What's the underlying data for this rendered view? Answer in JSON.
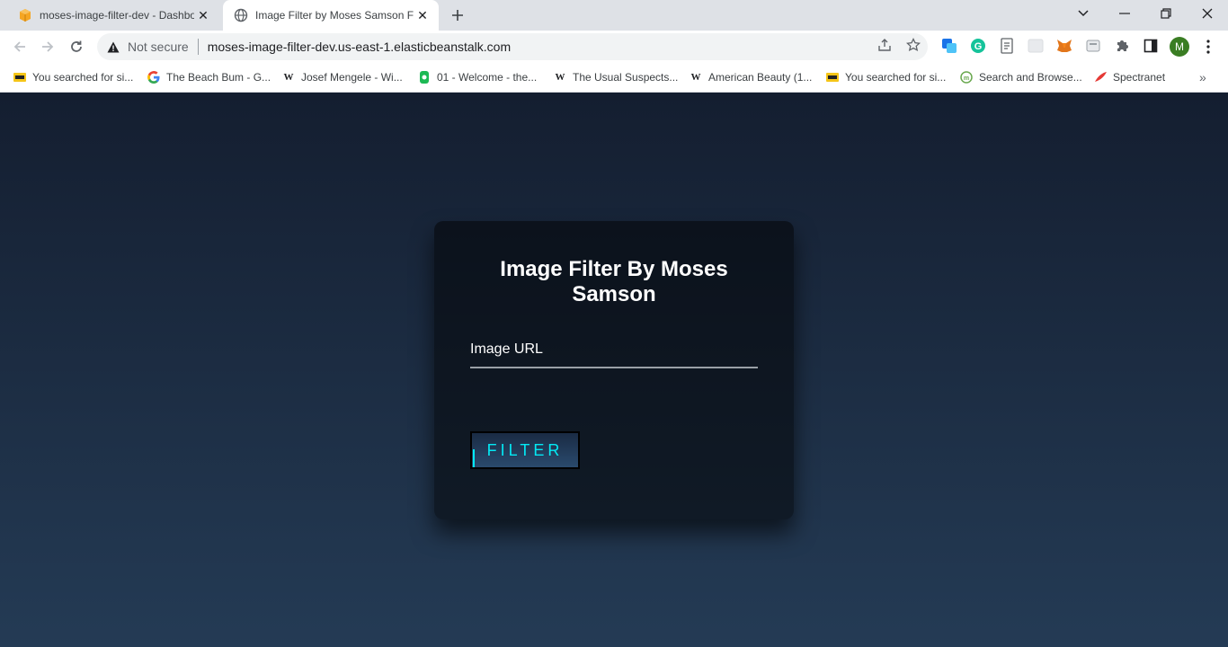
{
  "browser": {
    "tabs": [
      {
        "title": "moses-image-filter-dev - Dashbo",
        "icon": "aws-box-icon",
        "active": false
      },
      {
        "title": "Image Filter by Moses Samson Fo",
        "icon": "globe-icon",
        "active": true
      }
    ],
    "address": {
      "security_label": "Not secure",
      "url": "moses-image-filter-dev.us-east-1.elasticbeanstalk.com"
    },
    "bookmarks": [
      {
        "label": "You searched for si...",
        "icon": "imdb-icon"
      },
      {
        "label": "The Beach Bum - G...",
        "icon": "google-icon"
      },
      {
        "label": "Josef Mengele - Wi...",
        "icon": "wikipedia-icon"
      },
      {
        "label": "01 - Welcome - the...",
        "icon": "course-icon"
      },
      {
        "label": "The Usual Suspects...",
        "icon": "wikipedia-icon"
      },
      {
        "label": "American Beauty (1...",
        "icon": "wikipedia-icon"
      },
      {
        "label": "You searched for si...",
        "icon": "imdb-icon"
      },
      {
        "label": "Search and Browse...",
        "icon": "search-browse-icon"
      },
      {
        "label": "Spectranet",
        "icon": "spectranet-icon"
      }
    ],
    "profile_initial": "M"
  },
  "page": {
    "heading": "Image Filter By Moses Samson",
    "url_field": {
      "label": "Image URL",
      "value": ""
    },
    "filter_button": "FILTER"
  },
  "colors": {
    "background_top": "#141e30",
    "background_bottom": "#243b55",
    "accent": "#03e9f4"
  }
}
